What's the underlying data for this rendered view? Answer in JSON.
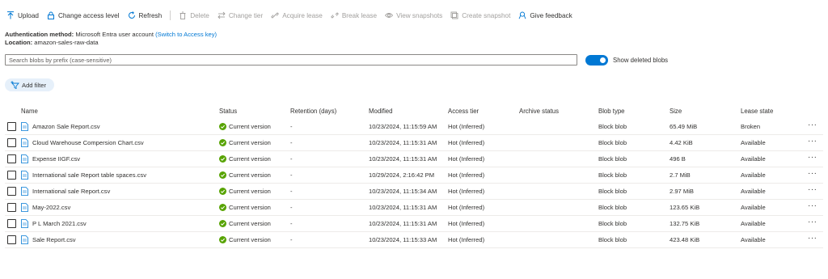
{
  "toolbar": {
    "upload": "Upload",
    "change_access_level": "Change access level",
    "refresh": "Refresh",
    "delete": "Delete",
    "change_tier": "Change tier",
    "acquire_lease": "Acquire lease",
    "break_lease": "Break lease",
    "view_snapshots": "View snapshots",
    "create_snapshot": "Create snapshot",
    "give_feedback": "Give feedback"
  },
  "info": {
    "auth_label": "Authentication method:",
    "auth_value": "Microsoft Entra user account",
    "auth_link": "(Switch to Access key)",
    "location_label": "Location:",
    "location_value": "amazon-sales-raw-data"
  },
  "search": {
    "placeholder": "Search blobs by prefix (case-sensitive)",
    "value": ""
  },
  "toggle": {
    "label": "Show deleted blobs",
    "on": true
  },
  "filter": {
    "add_label": "Add filter"
  },
  "table": {
    "headers": {
      "name": "Name",
      "status": "Status",
      "retention": "Retention (days)",
      "modified": "Modified",
      "access_tier": "Access tier",
      "archive_status": "Archive status",
      "blob_type": "Blob type",
      "size": "Size",
      "lease_state": "Lease state"
    },
    "rows": [
      {
        "name": "Amazon Sale Report.csv",
        "status": "Current version",
        "retention": "-",
        "modified": "10/23/2024, 11:15:59 AM",
        "access_tier": "Hot (Inferred)",
        "archive_status": "",
        "blob_type": "Block blob",
        "size": "65.49 MiB",
        "lease_state": "Broken"
      },
      {
        "name": "Cloud Warehouse Compersion Chart.csv",
        "status": "Current version",
        "retention": "-",
        "modified": "10/23/2024, 11:15:31 AM",
        "access_tier": "Hot (Inferred)",
        "archive_status": "",
        "blob_type": "Block blob",
        "size": "4.42 KiB",
        "lease_state": "Available"
      },
      {
        "name": "Expense IIGF.csv",
        "status": "Current version",
        "retention": "-",
        "modified": "10/23/2024, 11:15:31 AM",
        "access_tier": "Hot (Inferred)",
        "archive_status": "",
        "blob_type": "Block blob",
        "size": "496 B",
        "lease_state": "Available"
      },
      {
        "name": "International sale Report table spaces.csv",
        "status": "Current version",
        "retention": "-",
        "modified": "10/29/2024, 2:16:42 PM",
        "access_tier": "Hot (Inferred)",
        "archive_status": "",
        "blob_type": "Block blob",
        "size": "2.7 MiB",
        "lease_state": "Available"
      },
      {
        "name": "International sale Report.csv",
        "status": "Current version",
        "retention": "-",
        "modified": "10/23/2024, 11:15:34 AM",
        "access_tier": "Hot (Inferred)",
        "archive_status": "",
        "blob_type": "Block blob",
        "size": "2.97 MiB",
        "lease_state": "Available"
      },
      {
        "name": "May-2022.csv",
        "status": "Current version",
        "retention": "-",
        "modified": "10/23/2024, 11:15:31 AM",
        "access_tier": "Hot (Inferred)",
        "archive_status": "",
        "blob_type": "Block blob",
        "size": "123.65 KiB",
        "lease_state": "Available"
      },
      {
        "name": "P L March 2021.csv",
        "status": "Current version",
        "retention": "-",
        "modified": "10/23/2024, 11:15:31 AM",
        "access_tier": "Hot (Inferred)",
        "archive_status": "",
        "blob_type": "Block blob",
        "size": "132.75 KiB",
        "lease_state": "Available"
      },
      {
        "name": "Sale Report.csv",
        "status": "Current version",
        "retention": "-",
        "modified": "10/23/2024, 11:15:33 AM",
        "access_tier": "Hot (Inferred)",
        "archive_status": "",
        "blob_type": "Block blob",
        "size": "423.48 KiB",
        "lease_state": "Available"
      }
    ]
  },
  "colors": {
    "accent": "#0078d4",
    "success": "#57a300",
    "disabled": "#a19f9d"
  },
  "icons": {
    "upload": "upload-arrow-icon",
    "access": "lock-icon",
    "refresh": "refresh-icon",
    "file": "file-document-icon",
    "status": "check-circle-icon",
    "more": "more-ellipsis-icon"
  }
}
